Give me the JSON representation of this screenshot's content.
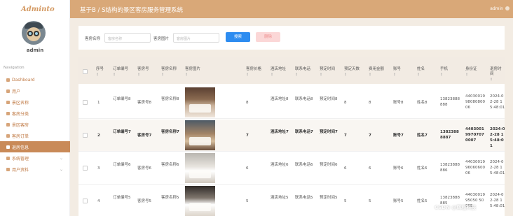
{
  "app": {
    "logo": "Adminto",
    "title": "基于B / S结构的景区客房服务管理系统",
    "header_user": "admin"
  },
  "sidebar": {
    "username": "admin",
    "nav_heading": "Navigation",
    "items": [
      {
        "label": "Dashboard"
      },
      {
        "label": "用户"
      },
      {
        "label": "景区名称"
      },
      {
        "label": "客房分类"
      },
      {
        "label": "景区客房"
      },
      {
        "label": "客房订单"
      },
      {
        "label": "退房信息"
      },
      {
        "label": "系统管理"
      },
      {
        "label": "用户资料"
      }
    ]
  },
  "search": {
    "name_label": "客房名称",
    "name_placeholder": "客房名称",
    "image_label": "客房图片",
    "image_placeholder": "客房图片",
    "search_button": "搜索",
    "delete_button": "删除"
  },
  "table": {
    "columns": [
      "序号",
      "订单编号",
      "客房号",
      "客房名称",
      "客房图片",
      "客房价格",
      "酒店地址",
      "联系电话",
      "预定时间",
      "预定天数",
      "费用金额",
      "账号",
      "姓名",
      "手机",
      "身份证",
      "退房时间"
    ],
    "rows": [
      {
        "index": "1",
        "order_no": "订单编号8",
        "room_no": "客房号8",
        "room_name": "客房名称8",
        "price": "8",
        "address": "酒店地址8",
        "phone": "联系电话8",
        "book_time": "预定时间8",
        "days": "8",
        "fee": "8",
        "account": "账号8",
        "name": "姓名8",
        "mobile": "13823888888",
        "id_card": "440300199808080006",
        "checkout": "2024-02-28 15:48:01"
      },
      {
        "index": "2",
        "order_no": "订单编号7",
        "room_no": "客房号7",
        "room_name": "客房名称7",
        "price": "7",
        "address": "酒店地址7",
        "phone": "联系电话7",
        "book_time": "预定时间7",
        "days": "7",
        "fee": "7",
        "account": "账号7",
        "name": "姓名7",
        "mobile": "13823888887",
        "id_card": "440300199707070007",
        "checkout": "2024-02-28 15:48:01"
      },
      {
        "index": "3",
        "order_no": "订单编号6",
        "room_no": "客房号6",
        "room_name": "客房名称6",
        "price": "6",
        "address": "酒店地址6",
        "phone": "联系电话6",
        "book_time": "预定时间6",
        "days": "6",
        "fee": "6",
        "account": "账号6",
        "name": "姓名6",
        "mobile": "13823888886",
        "id_card": "440300199606060006",
        "checkout": "2024-02-28 15:48:01"
      },
      {
        "index": "4",
        "order_no": "订单编号5",
        "room_no": "客房号5",
        "room_name": "客房名称5",
        "price": "5",
        "address": "酒店地址5",
        "phone": "联系电话5",
        "book_time": "预定时间5",
        "days": "5",
        "fee": "5",
        "account": "账号5",
        "name": "姓名5",
        "mobile": "13823888885",
        "id_card": "4403001995050 50005",
        "checkout": "2024-02-28 15:48:01"
      }
    ]
  },
  "watermark": "CSDN @辉程科技",
  "colors": {
    "header": "#d9a878",
    "accent": "#c98a58",
    "primary_button": "#2d8cf0",
    "danger_light": "#fbd7d7"
  }
}
